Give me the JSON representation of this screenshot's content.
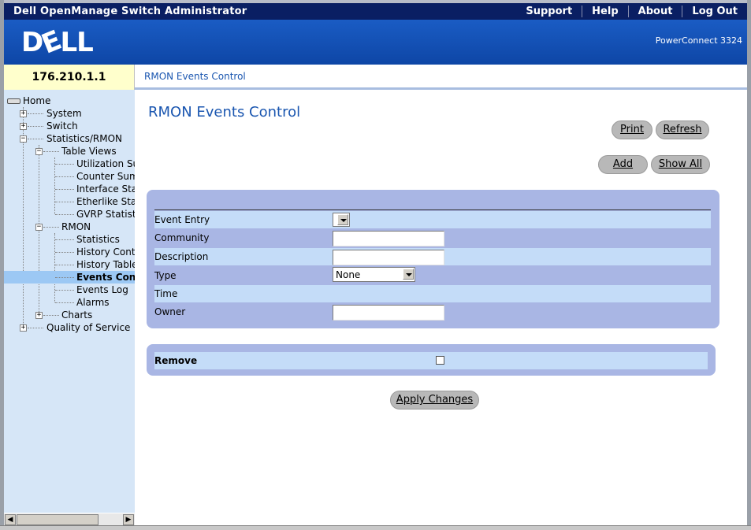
{
  "header": {
    "app_title": "Dell OpenManage Switch Administrator",
    "links": [
      "Support",
      "Help",
      "About",
      "Log Out"
    ],
    "logo_text": "DELL",
    "model": "PowerConnect 3324"
  },
  "device_ip": "176.210.1.1",
  "breadcrumb": "RMON Events Control",
  "tree": {
    "home": "Home",
    "system": "System",
    "switch": "Switch",
    "stats_rmon": "Statistics/RMON",
    "table_views": "Table Views",
    "utilization": "Utilization Summary",
    "counter": "Counter Summary",
    "interface_stats": "Interface Statistics",
    "etherlike": "Etherlike Statistics",
    "gvrp": "GVRP Statistics",
    "rmon": "RMON",
    "statistics": "Statistics",
    "history_control": "History Control",
    "history_table": "History Table",
    "events_control": "Events Control",
    "events_log": "Events Log",
    "alarms": "Alarms",
    "charts": "Charts",
    "qos": "Quality of Service"
  },
  "main": {
    "title": "RMON Events Control",
    "buttons": {
      "print": "Print",
      "refresh": "Refresh",
      "add": "Add",
      "show_all": "Show All",
      "apply": "Apply Changes"
    },
    "fields": {
      "event_entry": "Event Entry",
      "community": "Community",
      "description": "Description",
      "type": "Type",
      "type_value": "None",
      "time": "Time",
      "owner": "Owner"
    },
    "remove_label": "Remove"
  }
}
